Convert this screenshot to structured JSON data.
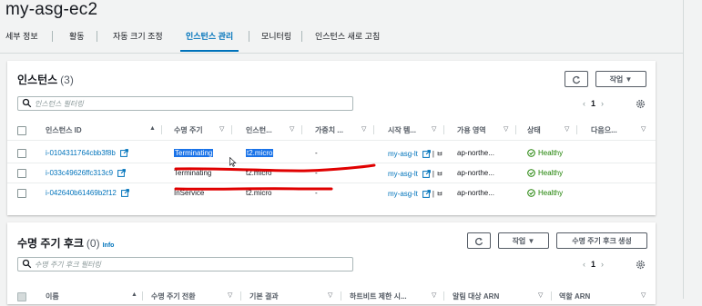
{
  "page": {
    "title": "my-asg-ec2"
  },
  "tabs": [
    {
      "label": "세부 정보"
    },
    {
      "label": "활동"
    },
    {
      "label": "자동 크기 조정"
    },
    {
      "label": "인스턴스 관리"
    },
    {
      "label": "모니터링"
    },
    {
      "label": "인스턴스 새로 고침"
    }
  ],
  "instances": {
    "title": "인스턴스",
    "count": "(3)",
    "actions_label": "작업 ▼",
    "search_placeholder": "인스턴스 필터링",
    "page_number": "1",
    "columns": [
      "인스턴스 ID",
      "수명 주기",
      "인스턴... ",
      "가중치 ...",
      "시작 템...",
      "가용 영역",
      "상태",
      "다음으..."
    ],
    "rows": [
      {
        "id": "i-0104311764cbb3f8b",
        "lifecycle": "Terminating",
        "type": "t2.micro",
        "weight": "-",
        "template": "my-asg-lt",
        "template_suffix": "| ㅂ",
        "az": "ap-northe...",
        "health": "Healthy"
      },
      {
        "id": "i-033c49626ffc313c9",
        "lifecycle": "Terminating",
        "type": "t2.micro",
        "weight": "-",
        "template": "my-asg-lt",
        "template_suffix": "| ㅂ",
        "az": "ap-northe...",
        "health": "Healthy"
      },
      {
        "id": "i-042640b61469b2f12",
        "lifecycle": "InService",
        "type": "t2.micro",
        "weight": "-",
        "template": "my-asg-lt",
        "template_suffix": "| ㅂ",
        "az": "ap-northe...",
        "health": "Healthy"
      }
    ]
  },
  "hooks": {
    "title": "수명 주기 후크",
    "count": "(0)",
    "info": "Info",
    "actions_label": "작업 ▼",
    "create_label": "수명 주기 후크 생성",
    "search_placeholder": "수명 주기 후크 필터링",
    "page_number": "1",
    "columns": [
      "이름",
      "수명 주기 전환",
      "기본 결과",
      "하트비트 제한 시...",
      "알림 대상 ARN",
      "역할 ARN"
    ]
  },
  "colors": {
    "accent": "#0073bb",
    "healthy": "#1d8102",
    "annotation": "#e00000"
  }
}
